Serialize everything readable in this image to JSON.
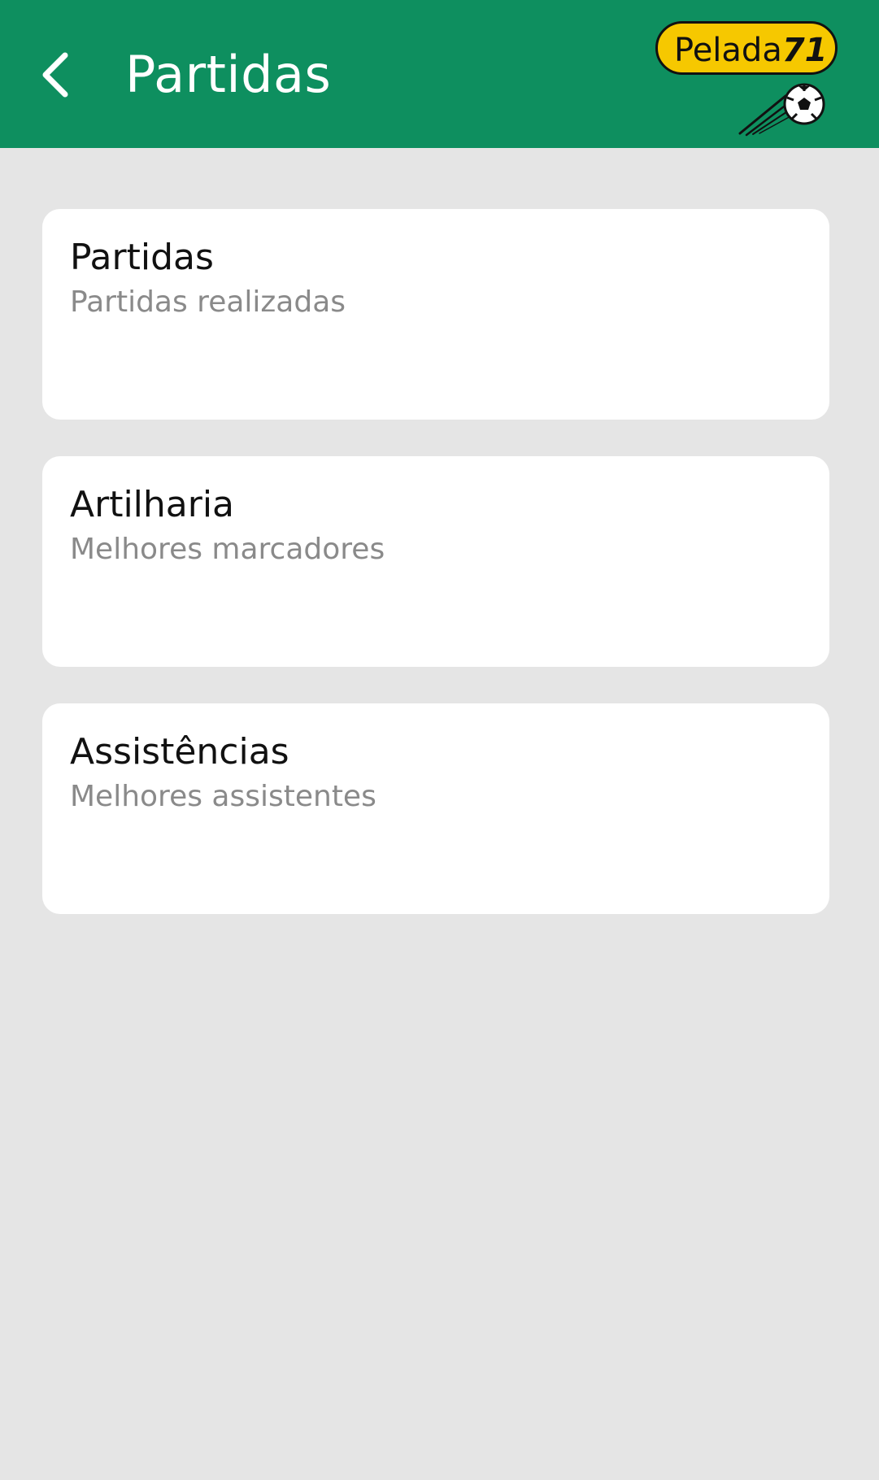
{
  "header": {
    "title": "Partidas",
    "back_icon": "chevron-left-icon",
    "background_color": "#0e8f5f",
    "title_color": "#ffffff"
  },
  "logo": {
    "word": "Pelada",
    "number": "71",
    "badge_color": "#f6c800",
    "icon": "soccer-ball-icon"
  },
  "cards": [
    {
      "title": "Partidas",
      "subtitle": "Partidas realizadas"
    },
    {
      "title": "Artilharia",
      "subtitle": "Melhores marcadores"
    },
    {
      "title": "Assistências",
      "subtitle": "Melhores assistentes"
    }
  ],
  "colors": {
    "page_background": "#e5e5e5",
    "card_background": "#ffffff",
    "card_title": "#111111",
    "card_subtitle": "#8a8a8a"
  }
}
